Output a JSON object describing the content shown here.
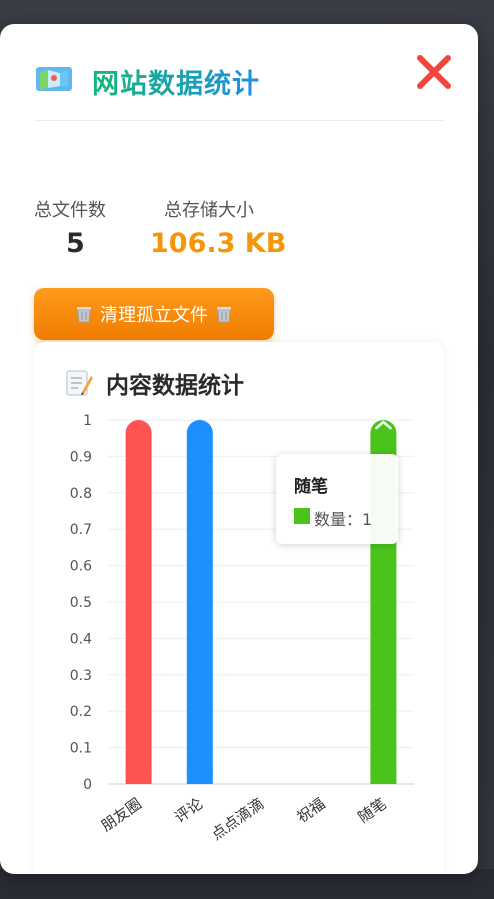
{
  "modal": {
    "title": "网站数据统计",
    "icon": "map-icon",
    "close_icon": "close-icon"
  },
  "stats": {
    "files_label": "总文件数",
    "files_value": "5",
    "storage_label": "总存储大小",
    "storage_value": "106.3 KB"
  },
  "clean_button": {
    "label": "清理孤立文件",
    "icon": "trash-icon"
  },
  "content_card": {
    "title": "内容数据统计",
    "icon": "memo-icon"
  },
  "tooltip": {
    "title": "随笔",
    "series_text": "数量：",
    "value": "1"
  },
  "chart_data": {
    "type": "bar",
    "categories": [
      "朋友圈",
      "评论",
      "点点滴滴",
      "祝福",
      "随笔"
    ],
    "values": [
      1,
      1,
      0,
      0,
      1
    ],
    "colors": [
      "#ff5353",
      "#1e8fff",
      "#ffb21e",
      "#b15eff",
      "#4ac41a"
    ],
    "yticks": [
      "0",
      "0.1",
      "0.2",
      "0.3",
      "0.4",
      "0.5",
      "0.6",
      "0.7",
      "0.8",
      "0.9",
      "1"
    ],
    "ylim": [
      0,
      1
    ],
    "grid": true,
    "series_name": "数量"
  }
}
